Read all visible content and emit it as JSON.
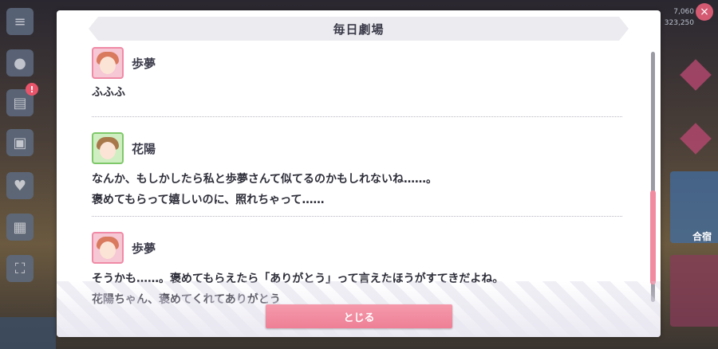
{
  "dialog": {
    "title": "毎日劇場",
    "close_label": "とじる"
  },
  "entries": [
    {
      "speaker": "歩夢",
      "avatar": "ayumu",
      "lines": [
        "ふふふ"
      ]
    },
    {
      "speaker": "花陽",
      "avatar": "hanayo",
      "lines": [
        "なんか、もしかしたら私と歩夢さんて似てるのかもしれないね……。",
        "褒めてもらって嬉しいのに、照れちゃって……"
      ]
    },
    {
      "speaker": "歩夢",
      "avatar": "ayumu",
      "lines": [
        "そうかも……。褒めてもらえたら「ありがとう」って言えたほうがすてきだよね。",
        "花陽ちゃん、褒めてくれてありがとう"
      ]
    }
  ],
  "background": {
    "stat_top": "7,060",
    "stat_bottom": "323,250",
    "badge": "!",
    "side_label": "合宿"
  },
  "colors": {
    "accent": "#ee7f95",
    "ayumu_frame": "#f08aa6",
    "hanayo_frame": "#7fc86a",
    "title_bar": "#ececf0"
  }
}
